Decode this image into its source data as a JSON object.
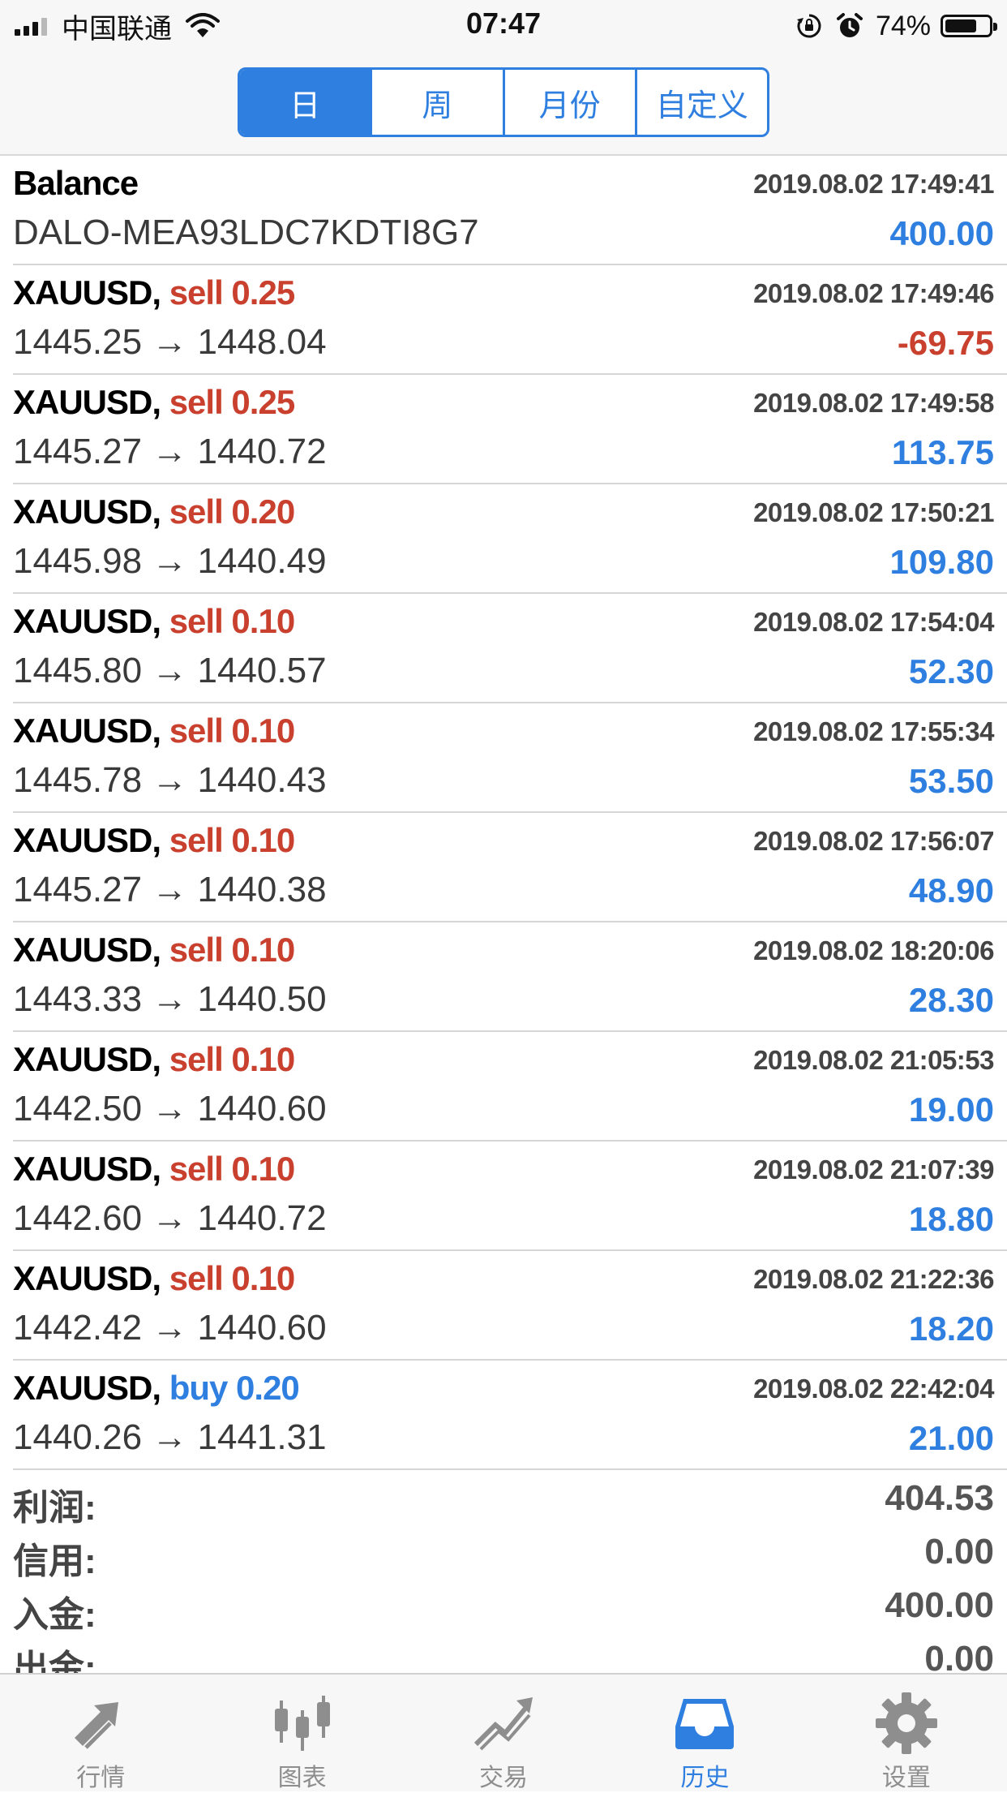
{
  "status_bar": {
    "carrier": "中国联通",
    "time": "07:47",
    "battery": "74%",
    "battery_level": 0.74
  },
  "segments": [
    {
      "label": "日",
      "active": true
    },
    {
      "label": "周",
      "active": false
    },
    {
      "label": "月份",
      "active": false
    },
    {
      "label": "自定义",
      "active": false
    }
  ],
  "balance": {
    "title": "Balance",
    "time": "2019.08.02 17:49:41",
    "comment": "DALO-MEA93LDC7KDTI8G7",
    "amount": "400.00"
  },
  "trades": [
    {
      "symbol": "XAUUSD,",
      "side": "sell 0.25",
      "time": "2019.08.02 17:49:46",
      "prices": "1445.25 → 1448.04",
      "profit": "-69.75"
    },
    {
      "symbol": "XAUUSD,",
      "side": "sell 0.25",
      "time": "2019.08.02 17:49:58",
      "prices": "1445.27 → 1440.72",
      "profit": "113.75"
    },
    {
      "symbol": "XAUUSD,",
      "side": "sell 0.20",
      "time": "2019.08.02 17:50:21",
      "prices": "1445.98 → 1440.49",
      "profit": "109.80"
    },
    {
      "symbol": "XAUUSD,",
      "side": "sell 0.10",
      "time": "2019.08.02 17:54:04",
      "prices": "1445.80 → 1440.57",
      "profit": "52.30"
    },
    {
      "symbol": "XAUUSD,",
      "side": "sell 0.10",
      "time": "2019.08.02 17:55:34",
      "prices": "1445.78 → 1440.43",
      "profit": "53.50"
    },
    {
      "symbol": "XAUUSD,",
      "side": "sell 0.10",
      "time": "2019.08.02 17:56:07",
      "prices": "1445.27 → 1440.38",
      "profit": "48.90"
    },
    {
      "symbol": "XAUUSD,",
      "side": "sell 0.10",
      "time": "2019.08.02 18:20:06",
      "prices": "1443.33 → 1440.50",
      "profit": "28.30"
    },
    {
      "symbol": "XAUUSD,",
      "side": "sell 0.10",
      "time": "2019.08.02 21:05:53",
      "prices": "1442.50 → 1440.60",
      "profit": "19.00"
    },
    {
      "symbol": "XAUUSD,",
      "side": "sell 0.10",
      "time": "2019.08.02 21:07:39",
      "prices": "1442.60 → 1440.72",
      "profit": "18.80"
    },
    {
      "symbol": "XAUUSD,",
      "side": "sell 0.10",
      "time": "2019.08.02 21:22:36",
      "prices": "1442.42 → 1440.60",
      "profit": "18.20"
    },
    {
      "symbol": "XAUUSD,",
      "side": "buy 0.20",
      "time": "2019.08.02 22:42:04",
      "prices": "1440.26 → 1441.31",
      "profit": "21.00"
    }
  ],
  "summary": [
    {
      "label": "利润:",
      "value": "404.53"
    },
    {
      "label": "信用:",
      "value": "0.00"
    },
    {
      "label": "入金:",
      "value": "400.00"
    },
    {
      "label": "出金:",
      "value": "0.00"
    }
  ],
  "tabs": [
    {
      "label": "行情",
      "icon": "quotes-arrows-icon",
      "active": false
    },
    {
      "label": "图表",
      "icon": "candlestick-chart-icon",
      "active": false
    },
    {
      "label": "交易",
      "icon": "trade-chart-icon",
      "active": false
    },
    {
      "label": "历史",
      "icon": "history-tray-icon",
      "active": true
    },
    {
      "label": "设置",
      "icon": "gear-icon",
      "active": false
    }
  ],
  "colors": {
    "accent": "#2f7fe0",
    "sell": "#c9412e",
    "loss": "#c9412e",
    "profit": "#2f7fe0",
    "inactive": "#8e8e8e"
  }
}
